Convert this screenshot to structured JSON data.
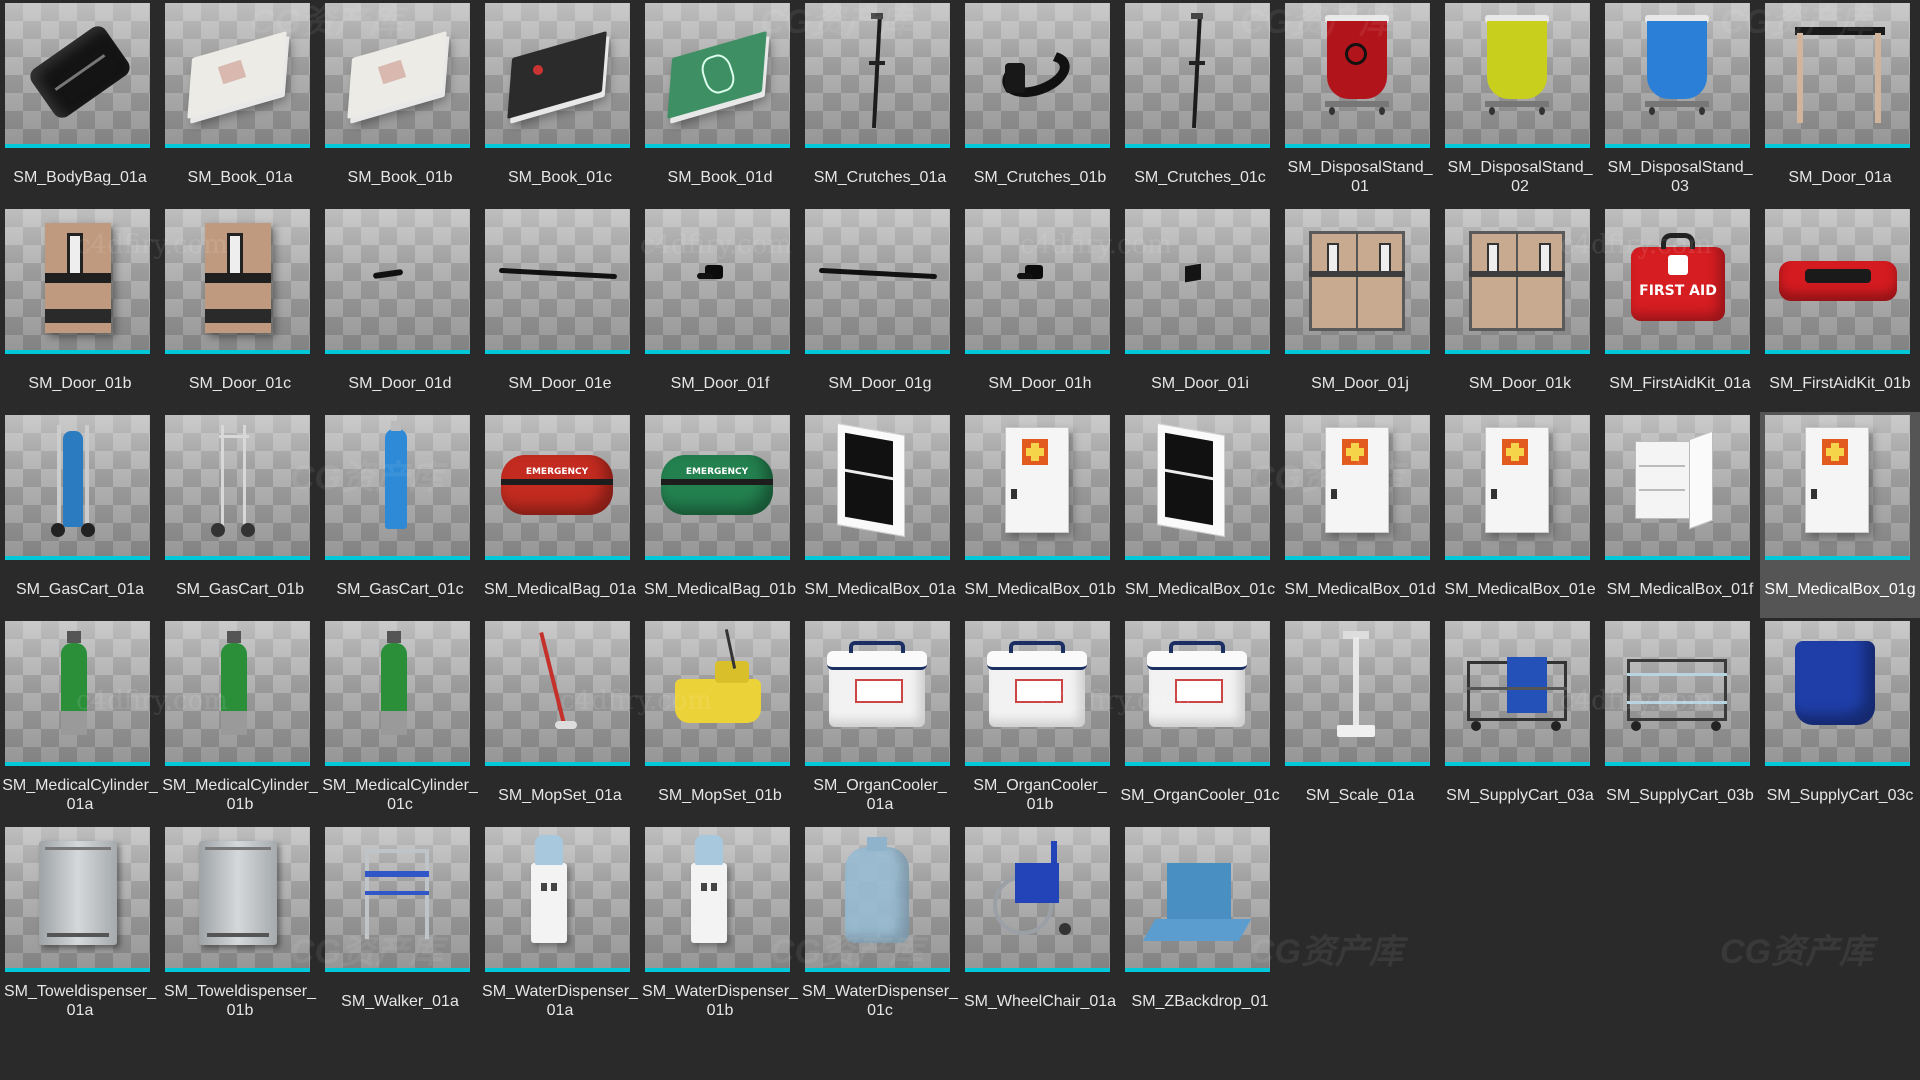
{
  "assets": [
    {
      "label": "SM_BodyBag_01a",
      "icon": "body-bag"
    },
    {
      "label": "SM_Book_01a",
      "icon": "book-white"
    },
    {
      "label": "SM_Book_01b",
      "icon": "book-white"
    },
    {
      "label": "SM_Book_01c",
      "icon": "book-dark"
    },
    {
      "label": "SM_Book_01d",
      "icon": "book-green"
    },
    {
      "label": "SM_Crutches_01a",
      "icon": "crutch"
    },
    {
      "label": "SM_Crutches_01b",
      "icon": "crutch-cuff"
    },
    {
      "label": "SM_Crutches_01c",
      "icon": "crutch"
    },
    {
      "label": "SM_DisposalStand_\n01",
      "icon": "disposal-red"
    },
    {
      "label": "SM_DisposalStand_\n02",
      "icon": "disposal-yellow"
    },
    {
      "label": "SM_DisposalStand_\n03",
      "icon": "disposal-blue"
    },
    {
      "label": "SM_Door_01a",
      "icon": "door-frame"
    },
    {
      "label": "SM_Door_01b",
      "icon": "door-panel"
    },
    {
      "label": "SM_Door_01c",
      "icon": "door-panel"
    },
    {
      "label": "SM_Door_01d",
      "icon": "door-handle"
    },
    {
      "label": "SM_Door_01e",
      "icon": "door-bar"
    },
    {
      "label": "SM_Door_01f",
      "icon": "door-knob"
    },
    {
      "label": "SM_Door_01g",
      "icon": "door-bar"
    },
    {
      "label": "SM_Door_01h",
      "icon": "door-knob"
    },
    {
      "label": "SM_Door_01i",
      "icon": "door-plate"
    },
    {
      "label": "SM_Door_01j",
      "icon": "door-double"
    },
    {
      "label": "SM_Door_01k",
      "icon": "door-double"
    },
    {
      "label": "SM_FirstAidKit_01a",
      "icon": "firstaid-kit",
      "text": "FIRST AID"
    },
    {
      "label": "SM_FirstAidKit_01b",
      "icon": "firstaid-flat"
    },
    {
      "label": "SM_GasCart_01a",
      "icon": "gascart"
    },
    {
      "label": "SM_GasCart_01b",
      "icon": "gascart-empty"
    },
    {
      "label": "SM_GasCart_01c",
      "icon": "gas-cylinder-blue"
    },
    {
      "label": "SM_MedicalBag_01a",
      "icon": "medbag-red",
      "text": "EMERGENCY"
    },
    {
      "label": "SM_MedicalBag_01b",
      "icon": "medbag-green",
      "text": "EMERGENCY"
    },
    {
      "label": "SM_MedicalBox_01a",
      "icon": "medbox-open-dark"
    },
    {
      "label": "SM_MedicalBox_01b",
      "icon": "medbox-cross"
    },
    {
      "label": "SM_MedicalBox_01c",
      "icon": "medbox-open-dark"
    },
    {
      "label": "SM_MedicalBox_01d",
      "icon": "medbox-cross"
    },
    {
      "label": "SM_MedicalBox_01e",
      "icon": "medbox-cross"
    },
    {
      "label": "SM_MedicalBox_01f",
      "icon": "medbox-open-white"
    },
    {
      "label": "SM_MedicalBox_01g",
      "icon": "medbox-cross",
      "selected": true
    },
    {
      "label": "SM_MedicalCylinder_\n01a",
      "icon": "cylinder-green"
    },
    {
      "label": "SM_MedicalCylinder_\n01b",
      "icon": "cylinder-green"
    },
    {
      "label": "SM_MedicalCylinder_\n01c",
      "icon": "cylinder-green"
    },
    {
      "label": "SM_MopSet_01a",
      "icon": "mop"
    },
    {
      "label": "SM_MopSet_01b",
      "icon": "mop-bucket"
    },
    {
      "label": "SM_OrganCooler_\n01a",
      "icon": "cooler"
    },
    {
      "label": "SM_OrganCooler_\n01b",
      "icon": "cooler"
    },
    {
      "label": "SM_OrganCooler_01c",
      "icon": "cooler"
    },
    {
      "label": "SM_Scale_01a",
      "icon": "scale"
    },
    {
      "label": "SM_SupplyCart_03a",
      "icon": "supplycart-blue"
    },
    {
      "label": "SM_SupplyCart_03b",
      "icon": "supplycart"
    },
    {
      "label": "SM_SupplyCart_03c",
      "icon": "supply-bag-blue"
    },
    {
      "label": "SM_Toweldispenser_\n01a",
      "icon": "towel-dispenser"
    },
    {
      "label": "SM_Toweldispenser_\n01b",
      "icon": "towel-dispenser"
    },
    {
      "label": "SM_Walker_01a",
      "icon": "walker"
    },
    {
      "label": "SM_WaterDispenser_\n01a",
      "icon": "water-dispenser"
    },
    {
      "label": "SM_WaterDispenser_\n01b",
      "icon": "water-dispenser"
    },
    {
      "label": "SM_WaterDispenser_\n01c",
      "icon": "water-jug"
    },
    {
      "label": "SM_WheelChair_01a",
      "icon": "wheelchair"
    },
    {
      "label": "SM_ZBackdrop_01",
      "icon": "backdrop"
    }
  ],
  "colors": {
    "background": "#2a2a2a",
    "thumbnail_underline": "#00c8d8",
    "selected_tile": "#555555",
    "label_text": "#e6e6e6"
  },
  "watermarks": {
    "cg": "CG资产库",
    "site": "c4dfiry.com"
  }
}
